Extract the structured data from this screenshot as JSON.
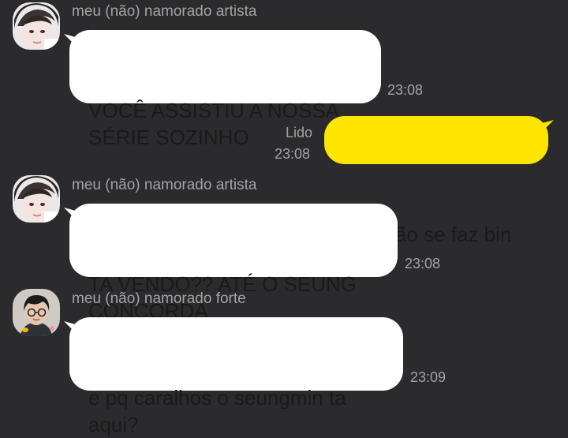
{
  "colors": {
    "background": "#2b2b2d",
    "incoming_bubble": "#ffffff",
    "outgoing_bubble": "#fee500",
    "meta_text": "#a3a3a3",
    "message_text": "#1a1a1a"
  },
  "messages": [
    {
      "sender": "meu (não) namorado artista",
      "avatar_icon": "profile-photo-icon",
      "text": "VOCÊ ASSISTIU A NOSSA\nSÉRIE SOZINHO",
      "time": "23:08"
    },
    {
      "outgoing": true,
      "read_label": "Lido",
      "text": "isso não se faz bin",
      "time": "23:08"
    },
    {
      "sender": "meu (não) namorado artista",
      "avatar_icon": "profile-photo-icon",
      "text": "TA VENDO?? ATÉ O SEUNG\nCONCORDA",
      "time": "23:08"
    },
    {
      "sender": "meu (não) namorado forte",
      "avatar_icon": "profile-photo-icon",
      "text": "e pq caralhos o seungmin ta\naqui?",
      "time": "23:09"
    }
  ]
}
